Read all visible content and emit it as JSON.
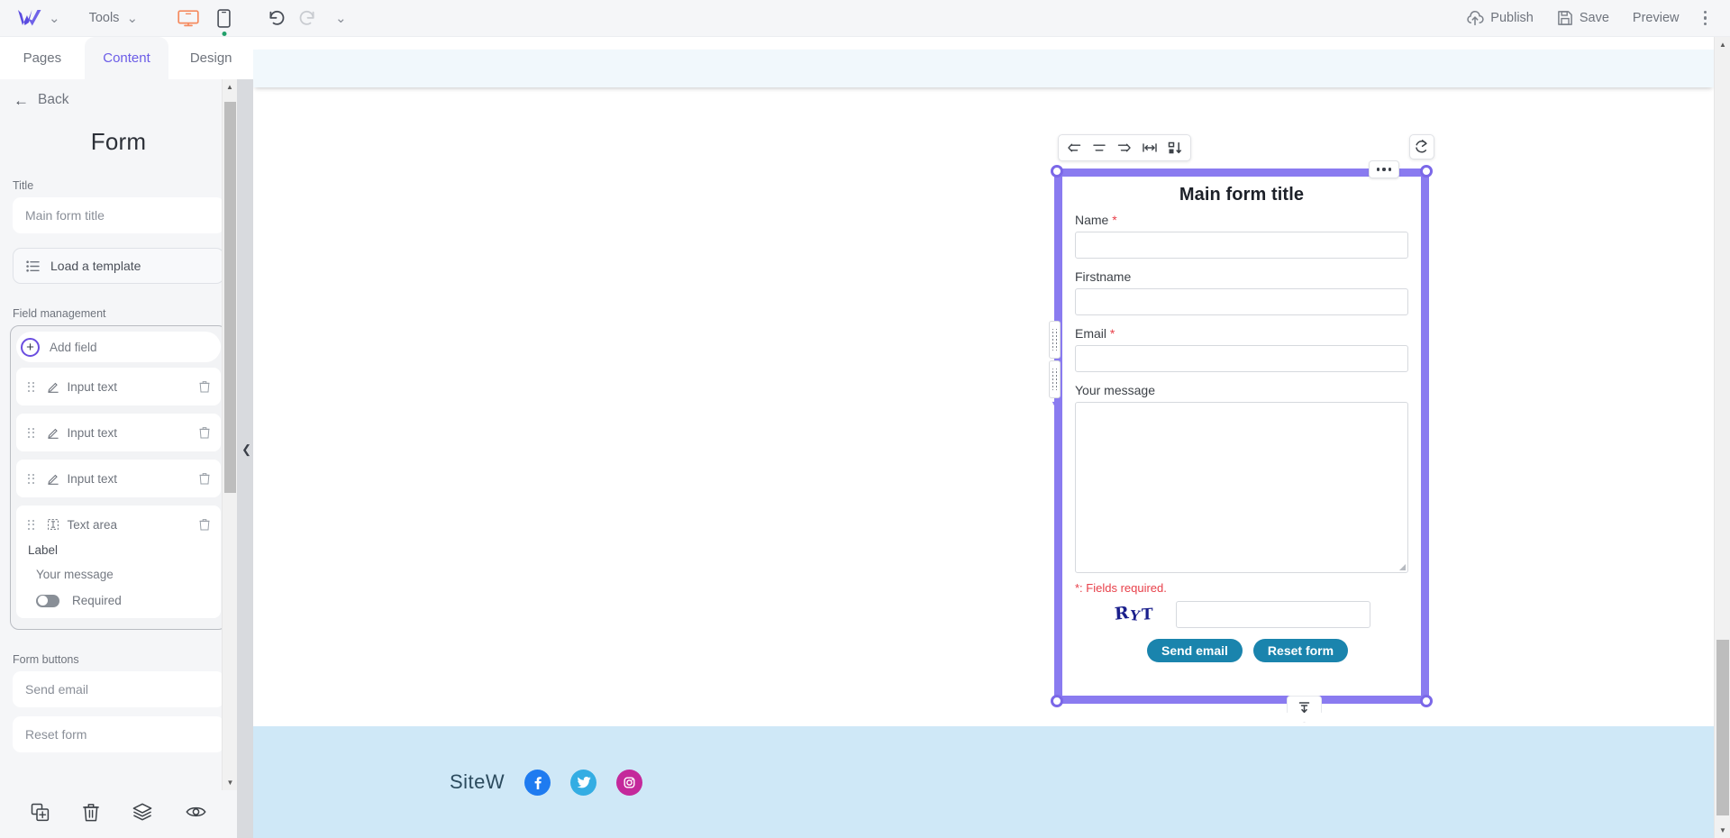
{
  "topbar": {
    "logo": "sitew-logo",
    "logo_caret": "⌄",
    "tools_label": "Tools",
    "tools_caret": "⌄",
    "desktop_icon": "desktop-monitor-icon",
    "mobile_icon": "mobile-phone-icon",
    "undo_icon": "undo-arrow-icon",
    "redo_icon": "redo-arrow-icon",
    "history_caret": "⌄",
    "publish_label": "Publish",
    "save_label": "Save",
    "preview_label": "Preview",
    "menu_icon": "kebab-menu-icon"
  },
  "sidebar": {
    "tabs": [
      {
        "label": "Pages",
        "active": false
      },
      {
        "label": "Content",
        "active": true
      },
      {
        "label": "Design",
        "active": false
      }
    ],
    "back_label": "Back",
    "back_icon": "arrow-left-icon",
    "panel_title": "Form",
    "title_section_label": "Title",
    "title_value": "Main form title",
    "load_template_label": "Load a template",
    "load_template_icon": "list-icon",
    "field_management_label": "Field management",
    "add_field_label": "Add field",
    "add_field_icon": "plus-circle-icon",
    "fields": [
      {
        "label": "Input text",
        "icon": "pencil-icon"
      },
      {
        "label": "Input text",
        "icon": "pencil-icon"
      },
      {
        "label": "Input text",
        "icon": "pencil-icon"
      }
    ],
    "selected_field": {
      "label": "Text area",
      "icon": "textarea-icon",
      "sub_label": "Label",
      "value": "Your message",
      "required_label": "Required",
      "required_on": false
    },
    "form_buttons_label": "Form buttons",
    "send_button_value": "Send email",
    "reset_button_value": "Reset form",
    "bottom_icons": [
      "duplicate-icon",
      "delete-icon",
      "layers-icon",
      "visibility-icon"
    ],
    "collapse_icon": "chevron-left-icon"
  },
  "element_toolbar": {
    "icons": [
      "align-left-icon",
      "align-center-icon",
      "align-right-icon",
      "width-adjust-icon",
      "sort-icon"
    ],
    "reload_icon": "reload-icon",
    "more_icon": "more-dots-icon",
    "move-down-icon": "move-down-icon"
  },
  "form": {
    "title": "Main form title",
    "fields": [
      {
        "label": "Name",
        "required": true,
        "type": "input",
        "required_mark": "*"
      },
      {
        "label": "Firstname",
        "required": false,
        "type": "input",
        "required_mark": ""
      },
      {
        "label": "Email",
        "required": true,
        "type": "input",
        "required_mark": "*"
      },
      {
        "label": "Your message",
        "required": false,
        "type": "textarea",
        "required_mark": ""
      }
    ],
    "required_note": "*: Fields required.",
    "captcha_text": "RYT",
    "captcha_chars": [
      "R",
      "Y",
      "T"
    ],
    "submit_label": "Send email",
    "reset_label": "Reset form"
  },
  "footer": {
    "brand": "SiteW",
    "social": [
      {
        "name": "facebook-icon",
        "color": "#1f7bf0"
      },
      {
        "name": "twitter-icon",
        "color": "#34ade3"
      },
      {
        "name": "instagram-icon",
        "color": "#c4299b"
      }
    ]
  },
  "colors": {
    "accent": "#6b5ce7",
    "selection": "#8a7bf0",
    "button": "#1a84ad",
    "required": "#e8404a",
    "footer_bg": "#cfe8f7",
    "band_bg": "#f1f8fc",
    "sidebar_bg": "#f5f6f8"
  },
  "scroll": {
    "up_arrow": "▲",
    "down_arrow": "▼"
  }
}
